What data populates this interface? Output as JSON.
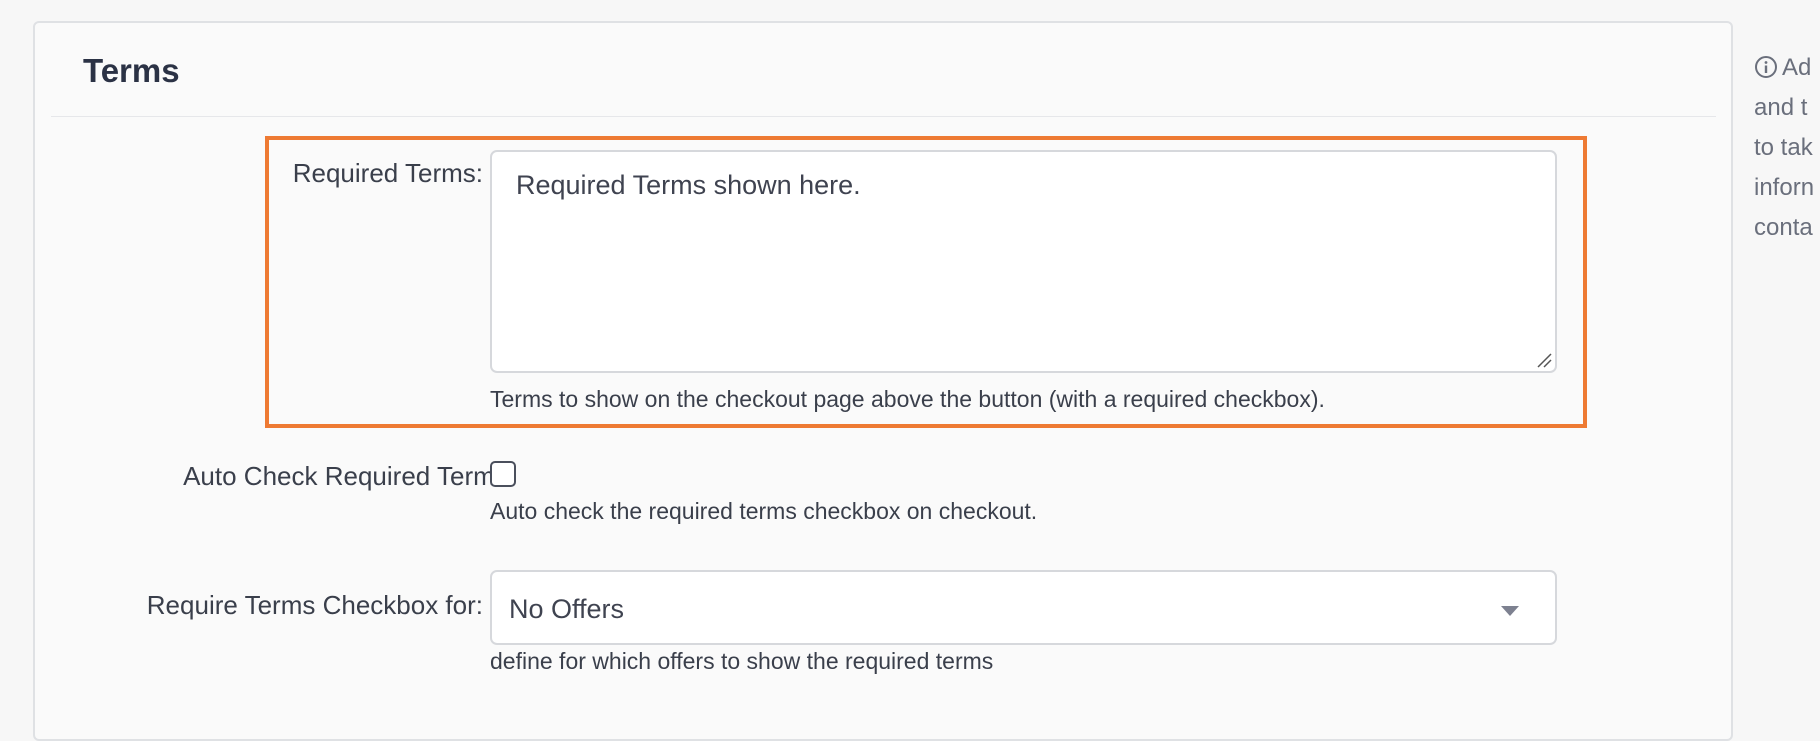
{
  "section": {
    "title": "Terms"
  },
  "required_terms": {
    "label": "Required Terms:",
    "value": "Required Terms shown here.",
    "help": "Terms to show on the checkout page above the button (with a required checkbox)."
  },
  "auto_check": {
    "label": "Auto Check Required Terms:",
    "checked": false,
    "help": "Auto check the required terms checkbox on checkout."
  },
  "require_for": {
    "label": "Require Terms Checkbox for:",
    "selected": "No Offers",
    "help": "define for which offers to show the required terms"
  },
  "sidebar": {
    "lines": [
      "Ad",
      "and t",
      "to tak",
      "inforn",
      "conta"
    ]
  },
  "colors": {
    "highlight": "#ee7a33",
    "title": "#2b3245"
  }
}
